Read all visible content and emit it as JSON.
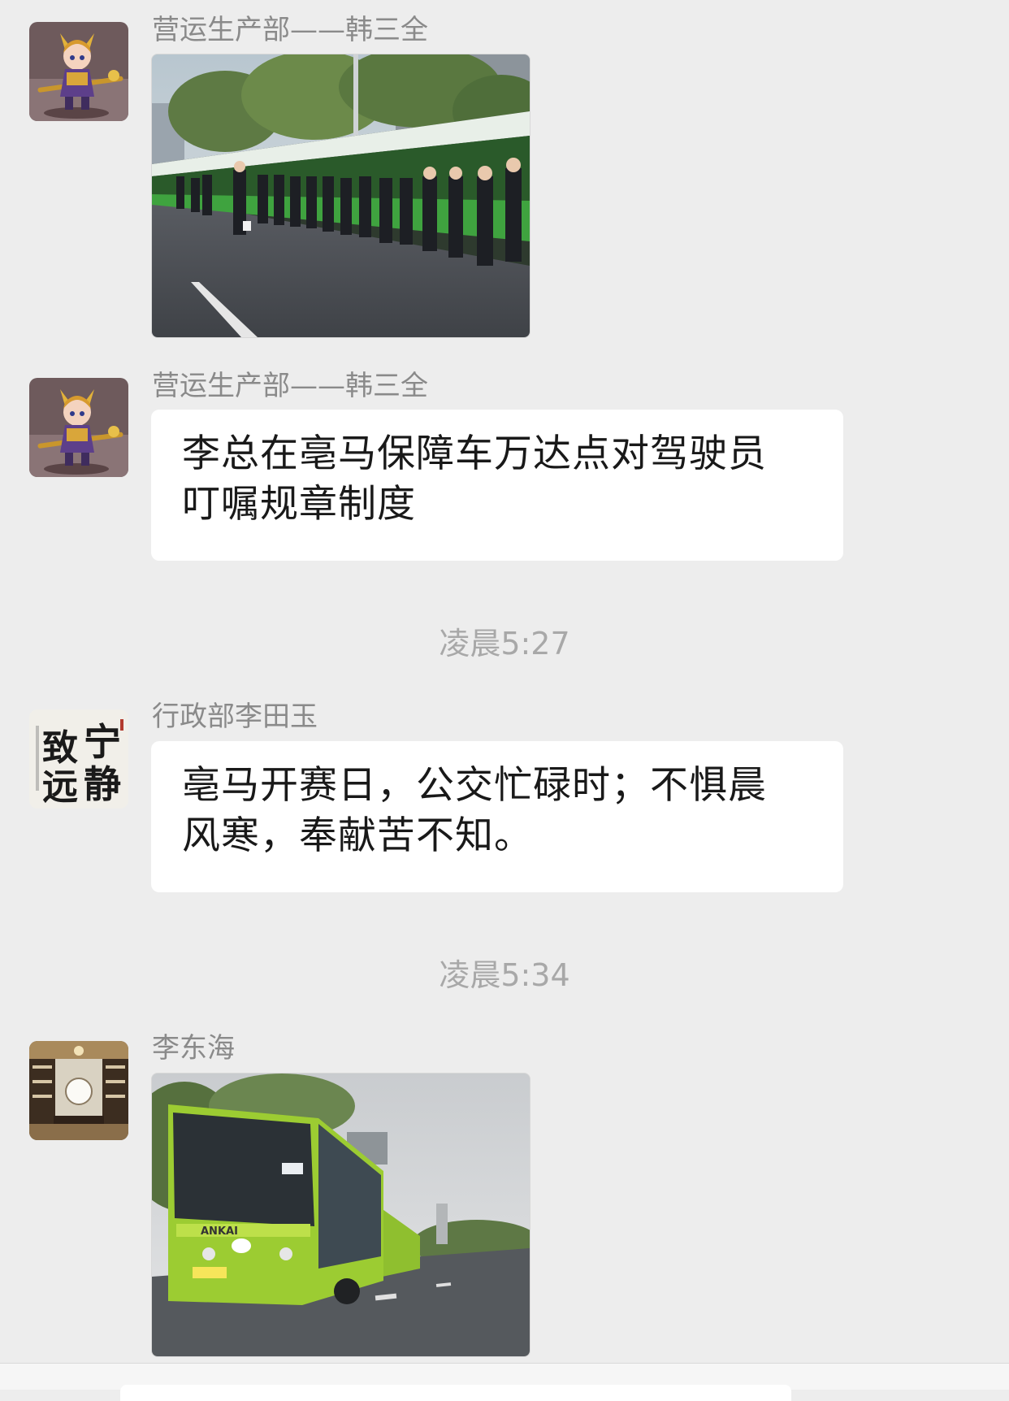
{
  "messages": [
    {
      "sender": "营运生产部——韩三全",
      "type": "image",
      "image_desc": "bus-drivers-lineup-photo",
      "avatar": "hero-warrior-avatar"
    },
    {
      "sender": "营运生产部——韩三全",
      "type": "text",
      "text_line1": "李总在亳马保障车万达点对驾驶员",
      "text_line2": "叮嘱规章制度",
      "avatar": "hero-warrior-avatar"
    },
    {
      "type": "timestamp",
      "text": "凌晨5:27"
    },
    {
      "sender": "行政部李田玉",
      "type": "text",
      "text_line1": "亳马开赛日，公交忙碌时；不惧晨",
      "text_line2": "风寒，奉献苦不知。",
      "avatar": "calligraphy-avatar",
      "avatar_text": [
        "宁",
        "静",
        "致",
        "远"
      ]
    },
    {
      "type": "timestamp",
      "text": "凌晨5:34"
    },
    {
      "sender": "李东海",
      "type": "image",
      "image_desc": "green-bus-on-road-photo",
      "avatar": "study-room-avatar"
    }
  ],
  "colors": {
    "background": "#ededed",
    "bubble": "#ffffff",
    "sender_text": "#8a8a8a",
    "timestamp_text": "#a8a8a8",
    "bus_green": "#9acd32"
  }
}
